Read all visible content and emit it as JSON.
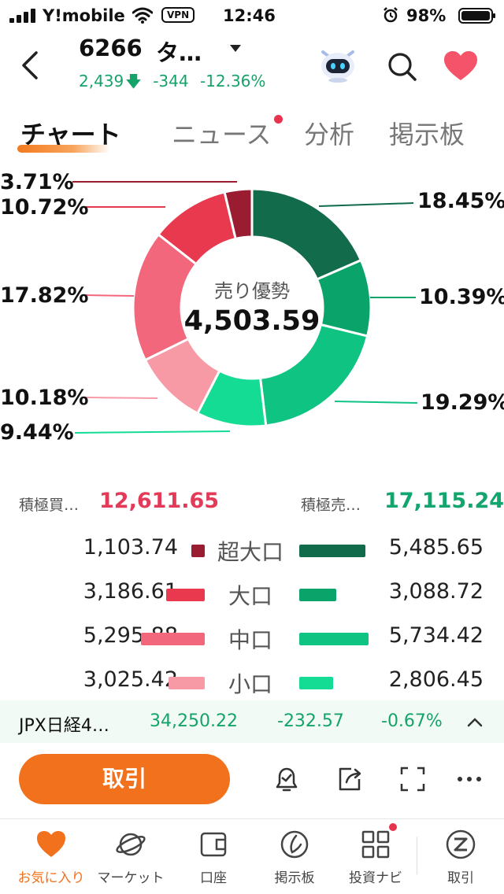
{
  "status_bar": {
    "carrier": "Y!mobile",
    "vpn": "VPN",
    "time": "12:46",
    "battery": "98%",
    "icons": [
      "signal-icon",
      "wifi-icon",
      "alarm-icon",
      "battery-icon"
    ]
  },
  "header": {
    "code": "6266",
    "name": "タ…",
    "price": "2,439",
    "change": "-344",
    "change_pct": "-12.36%",
    "colors": {
      "down": "#16a36a",
      "favorite": "#f4536a"
    },
    "icons": [
      "back-icon",
      "chevron-down-icon",
      "robot-icon",
      "search-icon",
      "heart-icon"
    ]
  },
  "tabs": [
    {
      "label": "チャート",
      "active": true
    },
    {
      "label": "ニュース",
      "active": false,
      "badge": true
    },
    {
      "label": "分析",
      "active": false
    },
    {
      "label": "掲示板",
      "active": false
    }
  ],
  "donut": {
    "center_label": "売り優勢",
    "center_value": "4,503.59",
    "segments": [
      {
        "pct": "18.45%",
        "value": 18.45,
        "color": "#126b4b"
      },
      {
        "pct": "10.39%",
        "value": 10.39,
        "color": "#0aa46a"
      },
      {
        "pct": "19.29%",
        "value": 19.29,
        "color": "#0fc383"
      },
      {
        "pct": "9.44%",
        "value": 9.44,
        "color": "#15dc95"
      },
      {
        "pct": "10.18%",
        "value": 10.18,
        "color": "#f79aa6"
      },
      {
        "pct": "17.82%",
        "value": 17.82,
        "color": "#f2677c"
      },
      {
        "pct": "10.72%",
        "value": 10.72,
        "color": "#e8394f"
      },
      {
        "pct": "3.71%",
        "value": 3.71,
        "color": "#9a1c30"
      }
    ]
  },
  "summary": {
    "buy_label": "積極買…",
    "buy_value": "12,611.65",
    "sell_label": "積極売…",
    "sell_value": "17,115.24",
    "buy_color": "#e23a57",
    "sell_color": "#12a56d"
  },
  "breakdown": [
    {
      "label": "超大口",
      "buy": "1,103.74",
      "sell": "5,485.65",
      "buy_num": 1103.74,
      "sell_num": 5485.65,
      "buy_color": "#9a1c30",
      "sell_color": "#126b4b"
    },
    {
      "label": "大口",
      "buy": "3,186.61",
      "sell": "3,088.72",
      "buy_num": 3186.61,
      "sell_num": 3088.72,
      "buy_color": "#e8394f",
      "sell_color": "#0aa46a"
    },
    {
      "label": "中口",
      "buy": "5,295.88",
      "sell": "5,734.42",
      "buy_num": 5295.88,
      "sell_num": 5734.42,
      "buy_color": "#f2677c",
      "sell_color": "#0fc383"
    },
    {
      "label": "小口",
      "buy": "3,025.42",
      "sell": "2,806.45",
      "buy_num": 3025.42,
      "sell_num": 2806.45,
      "buy_color": "#f79aa6",
      "sell_color": "#15dc95"
    }
  ],
  "ticker": {
    "name": "JPX日経4…",
    "value": "34,250.22",
    "change": "-232.57",
    "change_pct": "-0.67%"
  },
  "action_bar": {
    "trade_label": "取引",
    "icons": [
      "alert-bell-icon",
      "share-icon",
      "fullscreen-icon",
      "more-icon"
    ]
  },
  "bottom_nav": [
    {
      "label": "お気に入り",
      "icon": "heart-icon",
      "active": true
    },
    {
      "label": "マーケット",
      "icon": "planet-icon",
      "active": false
    },
    {
      "label": "口座",
      "icon": "wallet-icon",
      "active": false
    },
    {
      "label": "掲示板",
      "icon": "board-icon",
      "active": false
    },
    {
      "label": "投資ナビ",
      "icon": "grid-icon",
      "active": false,
      "badge": true
    },
    {
      "label": "取引",
      "icon": "trade-icon",
      "active": false
    }
  ]
}
